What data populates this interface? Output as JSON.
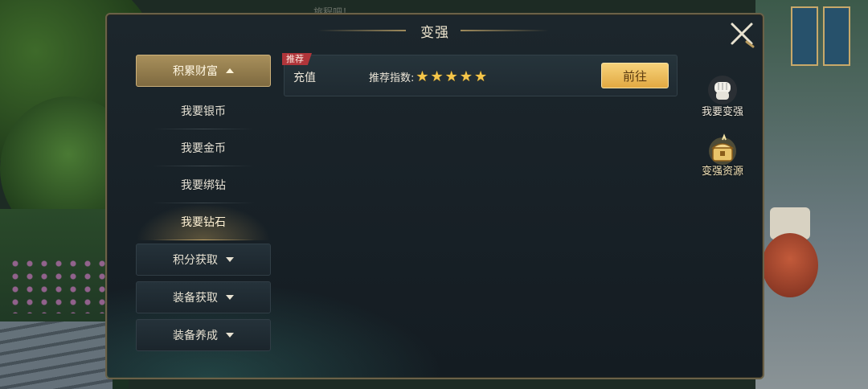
{
  "background": {
    "top_text": "旅程吧！"
  },
  "window": {
    "title": "变强",
    "close_icon": "close-x-icon"
  },
  "menu": {
    "categories": [
      {
        "label": "积累财富",
        "expanded": true,
        "items": [
          {
            "label": "我要银币"
          },
          {
            "label": "我要金币"
          },
          {
            "label": "我要绑钻"
          },
          {
            "label": "我要钻石",
            "selected": true
          }
        ]
      },
      {
        "label": "积分获取",
        "expanded": false
      },
      {
        "label": "装备获取",
        "expanded": false
      },
      {
        "label": "装备养成",
        "expanded": false
      }
    ]
  },
  "content": {
    "cards": [
      {
        "tag": "推荐",
        "name": "充值",
        "rating_label": "推荐指数:",
        "stars": 5,
        "button": "前往"
      }
    ]
  },
  "side_tabs": [
    {
      "label": "我要变强",
      "icon": "fist-icon"
    },
    {
      "label": "变强资源",
      "icon": "treasure-chest-icon",
      "active": true
    }
  ],
  "colors": {
    "accent_gold": "#e1a942",
    "active_menu": "#a88f5b",
    "tag_red": "#b0353a",
    "star": "#f4c64a"
  }
}
